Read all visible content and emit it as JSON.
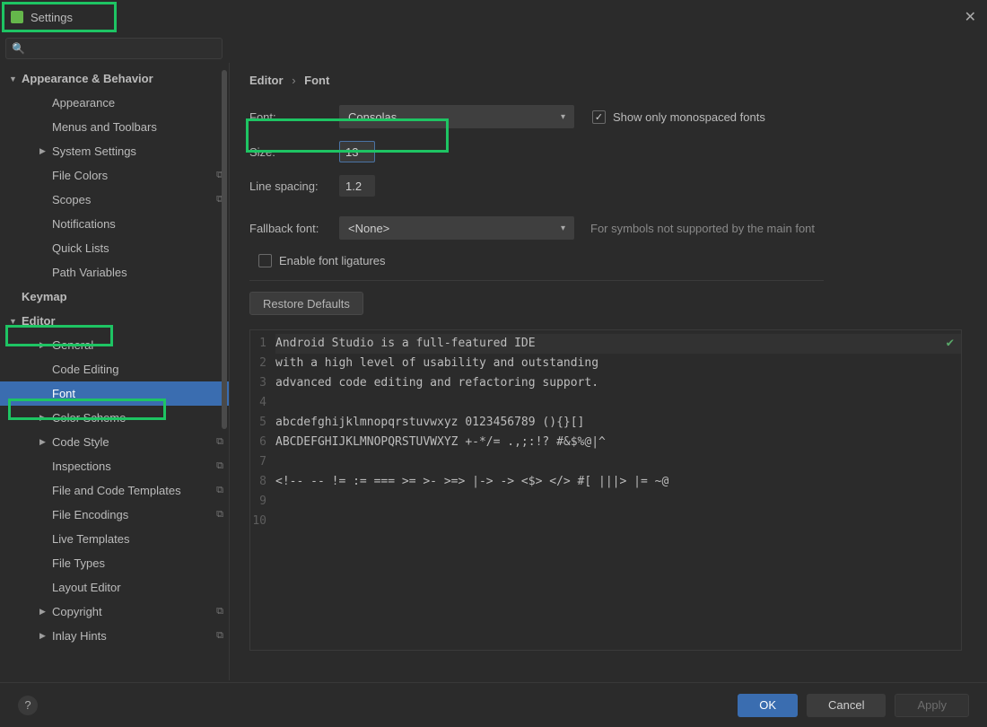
{
  "window": {
    "title": "Settings"
  },
  "search": {
    "placeholder": ""
  },
  "sidebar": {
    "items": [
      {
        "label": "Appearance & Behavior",
        "bold": true,
        "expanded": true
      },
      {
        "label": "Appearance"
      },
      {
        "label": "Menus and Toolbars"
      },
      {
        "label": "System Settings",
        "expandable": true
      },
      {
        "label": "File Colors",
        "copy": true
      },
      {
        "label": "Scopes",
        "copy": true
      },
      {
        "label": "Notifications"
      },
      {
        "label": "Quick Lists"
      },
      {
        "label": "Path Variables"
      },
      {
        "label": "Keymap",
        "bold": true,
        "top": true
      },
      {
        "label": "Editor",
        "bold": true,
        "expanded": true,
        "top": true
      },
      {
        "label": "General",
        "expandable": true
      },
      {
        "label": "Code Editing"
      },
      {
        "label": "Font",
        "selected": true
      },
      {
        "label": "Color Scheme",
        "expandable": true
      },
      {
        "label": "Code Style",
        "expandable": true,
        "copy": true
      },
      {
        "label": "Inspections",
        "copy": true
      },
      {
        "label": "File and Code Templates",
        "copy": true
      },
      {
        "label": "File Encodings",
        "copy": true
      },
      {
        "label": "Live Templates"
      },
      {
        "label": "File Types"
      },
      {
        "label": "Layout Editor"
      },
      {
        "label": "Copyright",
        "expandable": true,
        "copy": true
      },
      {
        "label": "Inlay Hints",
        "expandable": true,
        "copy": true
      }
    ]
  },
  "breadcrumb": {
    "part1": "Editor",
    "part2": "Font"
  },
  "form": {
    "font_label": "Font:",
    "font_value": "Consolas",
    "mono_label": "Show only monospaced fonts",
    "mono_checked": true,
    "size_label": "Size:",
    "size_value": "13",
    "spacing_label": "Line spacing:",
    "spacing_value": "1.2",
    "fallback_label": "Fallback font:",
    "fallback_value": "<None>",
    "fallback_hint": "For symbols not supported by the main font",
    "ligatures_label": "Enable font ligatures",
    "ligatures_checked": false,
    "restore_label": "Restore Defaults"
  },
  "preview": {
    "lines": [
      "Android Studio is a full-featured IDE",
      "with a high level of usability and outstanding",
      "advanced code editing and refactoring support.",
      "",
      "abcdefghijklmnopqrstuvwxyz 0123456789 (){}[]",
      "ABCDEFGHIJKLMNOPQRSTUVWXYZ +-*/= .,;:!? #&$%@|^",
      "",
      "<!-- -- != := === >= >- >=> |-> -> <$> </> #[ |||> |= ~@",
      "",
      ""
    ]
  },
  "footer": {
    "ok": "OK",
    "cancel": "Cancel",
    "apply": "Apply"
  }
}
